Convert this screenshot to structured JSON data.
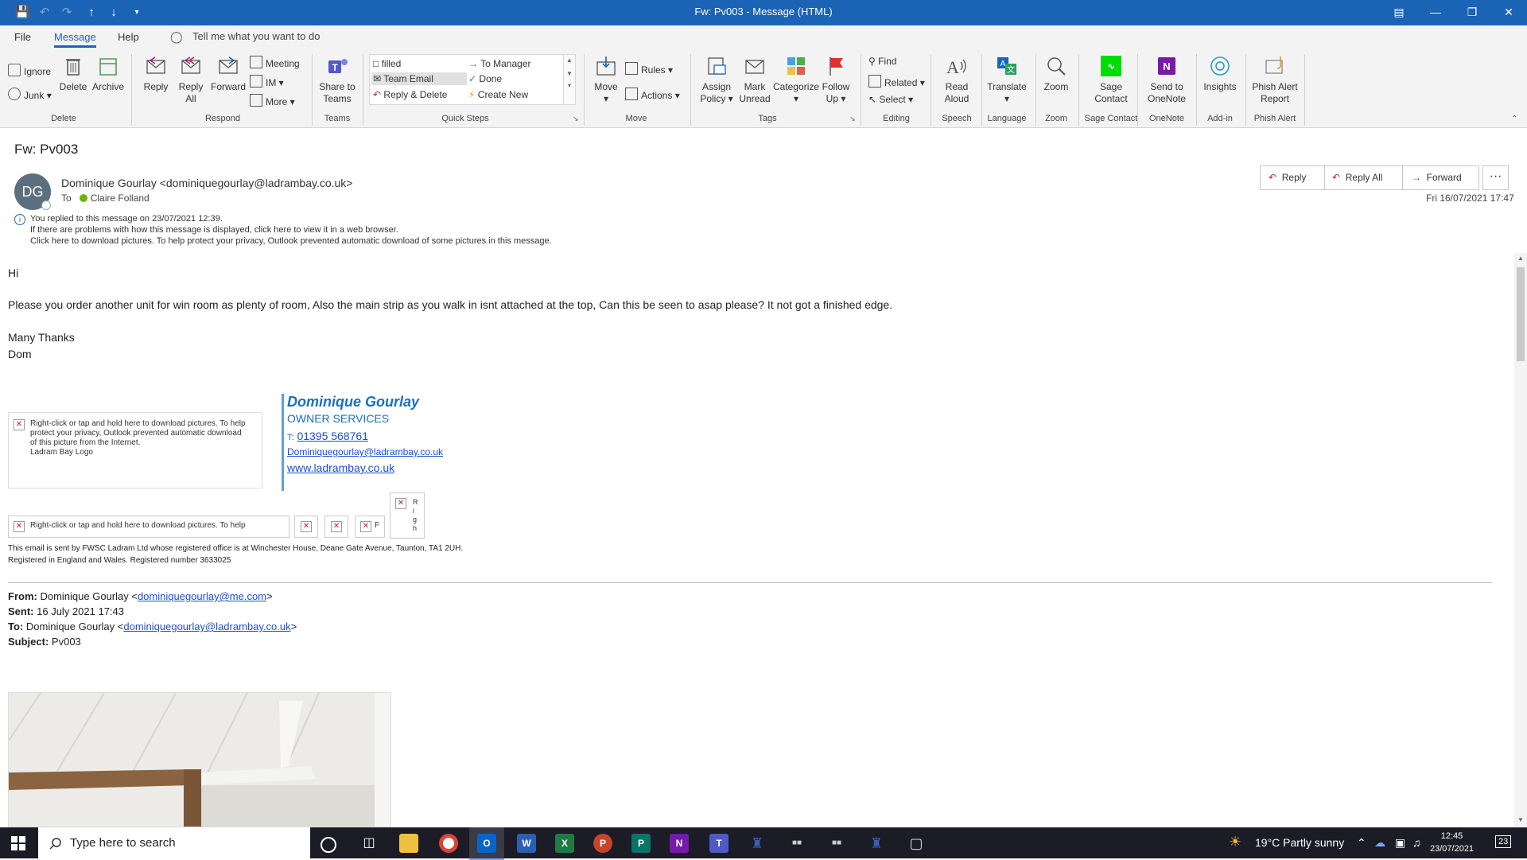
{
  "window": {
    "title": "Fw: Pv003  -  Message (HTML)"
  },
  "tabs": {
    "file": "File",
    "message": "Message",
    "help": "Help",
    "tell_me": "Tell me what you want to do"
  },
  "ribbon": {
    "delete_group": {
      "label": "Delete",
      "ignore": "Ignore",
      "junk": "Junk",
      "delete": "Delete",
      "archive": "Archive"
    },
    "respond_group": {
      "label": "Respond",
      "reply": "Reply",
      "reply_all_1": "Reply",
      "reply_all_2": "All",
      "forward": "Forward",
      "meeting": "Meeting",
      "im": "IM",
      "more": "More"
    },
    "teams_group": {
      "label": "Teams",
      "share_1": "Share to",
      "share_2": "Teams"
    },
    "quick_steps": {
      "label": "Quick Steps",
      "items": [
        "filled",
        "To Manager",
        "Team Email",
        "Done",
        "Reply & Delete",
        "Create New"
      ]
    },
    "move_group": {
      "label": "Move",
      "move": "Move",
      "rules": "Rules",
      "actions": "Actions"
    },
    "tags_group": {
      "label": "Tags",
      "assign_1": "Assign",
      "assign_2": "Policy",
      "mark_1": "Mark",
      "mark_2": "Unread",
      "categorize": "Categorize",
      "follow_1": "Follow",
      "follow_2": "Up"
    },
    "editing_group": {
      "label": "Editing",
      "find": "Find",
      "related": "Related",
      "select": "Select"
    },
    "speech_group": {
      "label": "Speech",
      "read_1": "Read",
      "read_2": "Aloud"
    },
    "language_group": {
      "label": "Language",
      "translate": "Translate"
    },
    "zoom_group": {
      "label": "Zoom",
      "zoom": "Zoom"
    },
    "sage_group": {
      "label": "Sage Contact",
      "sage_1": "Sage",
      "sage_2": "Contact"
    },
    "onenote_group": {
      "label": "OneNote",
      "send_1": "Send to",
      "send_2": "OneNote"
    },
    "addin_group": {
      "label": "Add-in",
      "insights": "Insights"
    },
    "phish_group": {
      "label": "Phish Alert",
      "phish_1": "Phish Alert",
      "phish_2": "Report"
    }
  },
  "message": {
    "subject": "Fw: Pv003",
    "avatar_initials": "DG",
    "sender": "Dominique Gourlay <dominiquegourlay@ladrambay.co.uk>",
    "to_label": "To",
    "recipient": "Claire Folland",
    "actions": {
      "reply": "Reply",
      "reply_all": "Reply All",
      "forward": "Forward",
      "more": "···"
    },
    "datetime": "Fri 16/07/2021 17:47",
    "info_lines": [
      "You replied to this message on 23/07/2021 12:39.",
      "If there are problems with how this message is displayed, click here to view it in a web browser.",
      "Click here to download pictures. To help protect your privacy, Outlook prevented automatic download of some pictures in this message."
    ],
    "body": {
      "greeting": "Hi",
      "paragraph": "Please you order another unit for win room as plenty of room, Also the main strip as you walk in isnt attached at the top, Can this be seen to asap please? It not got a finished edge.",
      "thanks": "Many Thanks",
      "name": "Dom"
    },
    "signature": {
      "logo_placeholder": [
        "Right-click or tap and hold here to download pictures. To help",
        "protect your privacy, Outlook prevented automatic download",
        "of this picture from the Internet.",
        "Ladram Bay Logo"
      ],
      "name": "Dominique Gourlay",
      "role": "OWNER SERVICES",
      "phone_prefix": "T:",
      "phone": "01395 568761",
      "email": "Dominiquegourlay@ladrambay.co.uk",
      "website": "www.ladrambay.co.uk",
      "banner_placeholder": "Right-click or tap and hold here to download pictures. To help",
      "small_letters": [
        "R",
        "i",
        "g",
        "h"
      ],
      "small_letter_2": "F"
    },
    "legal": [
      "This email is sent by FWSC Ladram Ltd whose registered office is at Winchester House, Deane Gate Avenue, Taunton, TA1 2UH.",
      "Registered in England and Wales. Registered number 3633025"
    ],
    "forwarded": {
      "from_label": "From:",
      "from_name": "Dominique Gourlay <",
      "from_email": "dominiquegourlay@me.com",
      "from_end": ">",
      "sent_label": "Sent:",
      "sent": "16 July 2021 17:43",
      "to_label": "To:",
      "to_name": "Dominique Gourlay <",
      "to_email": "dominiquegourlay@ladrambay.co.uk",
      "to_end": ">",
      "subject_label": "Subject:",
      "subject": "Pv003"
    }
  },
  "taskbar": {
    "search_placeholder": "Type here to search",
    "apps": [
      "O",
      "W",
      "X",
      "P",
      "P",
      "N",
      "T"
    ],
    "weather": "19°C  Partly sunny",
    "time": "12:45",
    "date": "23/07/2021",
    "notifications": "23"
  },
  "colors": {
    "accent": "#1b63b5",
    "signature_blue": "#1a6fbf",
    "link": "#1a4fd8",
    "taskbar": "#1b1c25"
  }
}
